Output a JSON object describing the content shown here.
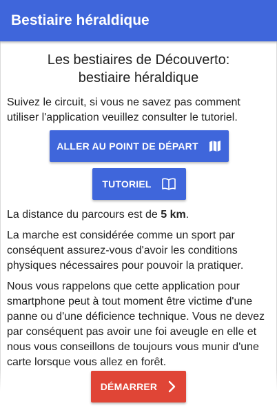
{
  "app_bar": {
    "title": "Bestiaire héraldique"
  },
  "main": {
    "title_line1": "Les bestiaires de Découverto:",
    "title_line2": "bestiaire héraldique",
    "intro": "Suivez le circuit, si vous ne savez pas comment utiliser l'application veuillez consulter le tutoriel.",
    "goto_start_button": {
      "label": "ALLER AU POINT DE DÉPART",
      "icon": "map-icon"
    },
    "tutorial_button": {
      "label": "TUTORIEL",
      "icon": "book-icon"
    },
    "distance": {
      "prefix": "La distance du parcours est de ",
      "value": "5 km",
      "suffix": "."
    },
    "sport_notice": "La marche est considérée comme un sport par conséquent assurez-vous d'avoir les conditions physiques nécessaires pour pouvoir la pratiquer.",
    "technical_notice": "Nous vous rappelons que cette application pour smartphone peut à tout moment être victime d'une panne ou d'une déficience technique. Vous ne devez par conséquent pas avoir une foi aveugle en elle et nous vous conseillons de toujours vous munir d'une carte lorsque vous allez en forêt."
  },
  "footer": {
    "start_button": {
      "label": "DÉMARRER",
      "icon": "chevron-right-icon"
    }
  },
  "colors": {
    "primary": "#3f66db",
    "start_button": "#e04536",
    "text": "#222222"
  }
}
